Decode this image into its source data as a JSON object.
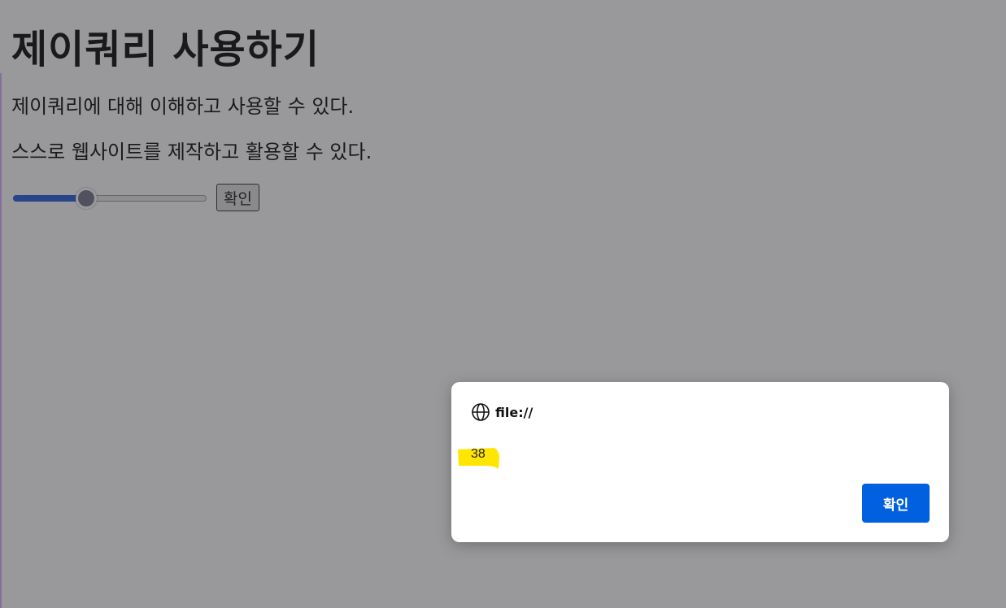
{
  "page": {
    "heading": "제이쿼리 사용하기",
    "paragraphs": [
      "제이쿼리에 대해 이해하고 사용할 수 있다.",
      "스스로 웹사이트를 제작하고 활용할 수 있다."
    ],
    "slider": {
      "min": 0,
      "max": 100,
      "value": 38
    },
    "button_label": "확인"
  },
  "dialog": {
    "origin": "file://",
    "message": "38",
    "ok_label": "확인",
    "icon": "globe-icon",
    "highlight_color": "#ffe600",
    "button_color": "#0160e0"
  }
}
